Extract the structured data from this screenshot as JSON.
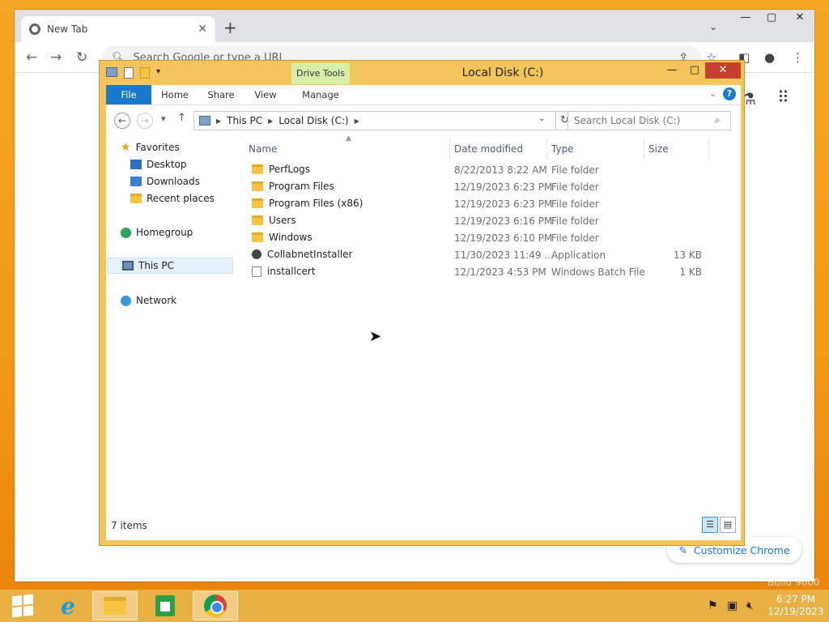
{
  "chrome": {
    "tab_title": "New Tab",
    "omnibox_placeholder": "Search Google or type a URL",
    "customize_label": "Customize Chrome",
    "faint_text": "Build 9600"
  },
  "explorer": {
    "window_title": "Local Disk (C:)",
    "context_tab_label": "Drive Tools",
    "ribbon_tabs": [
      "File",
      "Home",
      "Share",
      "View",
      "Manage"
    ],
    "breadcrumb": [
      "This PC",
      "Local Disk (C:)"
    ],
    "search_placeholder": "Search Local Disk (C:)",
    "nav": {
      "favorites": "Favorites",
      "desktop": "Desktop",
      "downloads": "Downloads",
      "recent": "Recent places",
      "homegroup": "Homegroup",
      "this_pc": "This PC",
      "network": "Network"
    },
    "columns": [
      "Name",
      "Date modified",
      "Type",
      "Size"
    ],
    "files": [
      {
        "name": "PerfLogs",
        "date": "8/22/2013 8:22 AM",
        "type": "File folder",
        "size": "",
        "icon": "folder-icon"
      },
      {
        "name": "Program Files",
        "date": "12/19/2023 6:23 PM",
        "type": "File folder",
        "size": "",
        "icon": "folder-icon"
      },
      {
        "name": "Program Files (x86)",
        "date": "12/19/2023 6:23 PM",
        "type": "File folder",
        "size": "",
        "icon": "folder-icon"
      },
      {
        "name": "Users",
        "date": "12/19/2023 6:16 PM",
        "type": "File folder",
        "size": "",
        "icon": "folder-icon"
      },
      {
        "name": "Windows",
        "date": "12/19/2023 6:10 PM",
        "type": "File folder",
        "size": "",
        "icon": "folder-icon"
      },
      {
        "name": "CollabnetInstaller",
        "date": "11/30/2023 11:49 ...",
        "type": "Application",
        "size": "13 KB",
        "icon": "application-icon"
      },
      {
        "name": "installcert",
        "date": "12/1/2023 4:53 PM",
        "type": "Windows Batch File",
        "size": "1 KB",
        "icon": "batch-file-icon"
      }
    ],
    "status": "7 items"
  },
  "taskbar": {
    "time": "6:27 PM",
    "date": "12/19/2023"
  }
}
